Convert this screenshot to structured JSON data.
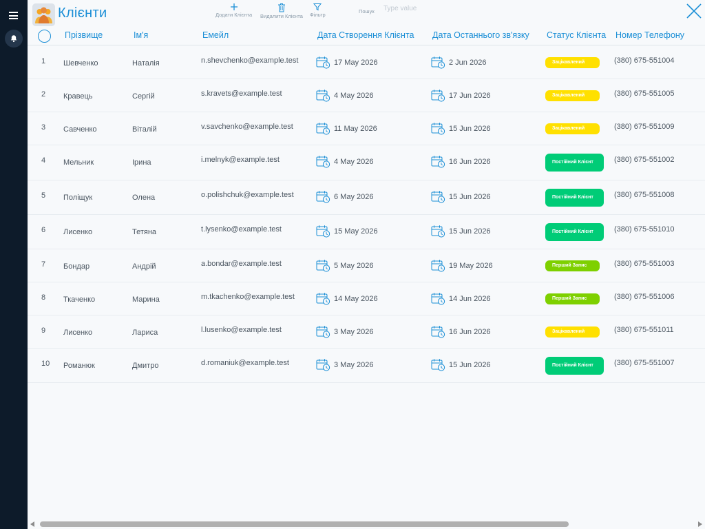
{
  "app": {
    "title": "Клієнти"
  },
  "toolbar": {
    "add_label": "Додати Клієнта",
    "delete_label": "Видалити Клієнта",
    "filter_label": "Фільтр",
    "search_label": "Пошук",
    "search_placeholder": "Type value",
    "search_value": ""
  },
  "colors": {
    "accent": "#1a8ed6",
    "sidebar": "#0d1b2a",
    "status_reserved": "#ffe000",
    "status_regular": "#00cc77",
    "status_first": "#7ed000"
  },
  "icons": {
    "menu": "hamburger-icon",
    "notifications": "bell-icon",
    "add": "plus-icon",
    "delete": "trash-icon",
    "filter": "filter-icon",
    "close": "close-icon",
    "date": "calendar-clock-icon"
  },
  "table": {
    "columns": [
      "Прізвище",
      "Ім'я",
      "Емейл",
      "Дата Створення Клієнта",
      "Дата Останнього зв'язку",
      "Статус Клієнта",
      "Номер Телефону"
    ],
    "rows": [
      {
        "num": "1",
        "surname": "Шевченко",
        "name": "Наталія",
        "email": "n.shevchenko@example.test",
        "created": "17 May 2026",
        "last_contact": "2 Jun 2026",
        "status": "Зацікавлений",
        "status_type": "reserved",
        "phone": "(380) 675-551004"
      },
      {
        "num": "2",
        "surname": "Кравець",
        "name": "Сергій",
        "email": "s.kravets@example.test",
        "created": "4 May 2026",
        "last_contact": "17 Jun 2026",
        "status": "Зацікавлений",
        "status_type": "reserved",
        "phone": "(380) 675-551005"
      },
      {
        "num": "3",
        "surname": "Савченко",
        "name": "Віталій",
        "email": "v.savchenko@example.test",
        "created": "11 May 2026",
        "last_contact": "15 Jun 2026",
        "status": "Зацікавлений",
        "status_type": "reserved",
        "phone": "(380) 675-551009"
      },
      {
        "num": "4",
        "surname": "Мельник",
        "name": "Ірина",
        "email": "i.melnyk@example.test",
        "created": "4 May 2026",
        "last_contact": "16 Jun 2026",
        "status": "Постійний Клієнт",
        "status_type": "regular",
        "phone": "(380) 675-551002"
      },
      {
        "num": "5",
        "surname": "Поліщук",
        "name": "Олена",
        "email": "o.polishchuk@example.test",
        "created": "6 May 2026",
        "last_contact": "15 Jun 2026",
        "status": "Постійний Клієнт",
        "status_type": "regular",
        "phone": "(380) 675-551008"
      },
      {
        "num": "6",
        "surname": "Лисенко",
        "name": "Тетяна",
        "email": "t.lysenko@example.test",
        "created": "15 May 2026",
        "last_contact": "15 Jun 2026",
        "status": "Постійний Клієнт",
        "status_type": "regular",
        "phone": "(380) 675-551010"
      },
      {
        "num": "7",
        "surname": "Бондар",
        "name": "Андрій",
        "email": "a.bondar@example.test",
        "created": "5 May 2026",
        "last_contact": "19 May 2026",
        "status": "Перший Запис",
        "status_type": "first",
        "phone": "(380) 675-551003"
      },
      {
        "num": "8",
        "surname": "Ткаченко",
        "name": "Марина",
        "email": "m.tkachenko@example.test",
        "created": "14 May 2026",
        "last_contact": "14 Jun 2026",
        "status": "Перший Запис",
        "status_type": "first",
        "phone": "(380) 675-551006"
      },
      {
        "num": "9",
        "surname": "Лисенко",
        "name": "Лариса",
        "email": "l.lusenko@example.test",
        "created": "3 May 2026",
        "last_contact": "16 Jun 2026",
        "status": "Зацікавлений",
        "status_type": "reserved",
        "phone": "(380) 675-551011"
      },
      {
        "num": "10",
        "surname": "Романюк",
        "name": "Дмитро",
        "email": "d.romaniuk@example.test",
        "created": "3 May 2026",
        "last_contact": "15 Jun 2026",
        "status": "Постійний Клієнт",
        "status_type": "regular",
        "phone": "(380) 675-551007"
      }
    ]
  }
}
